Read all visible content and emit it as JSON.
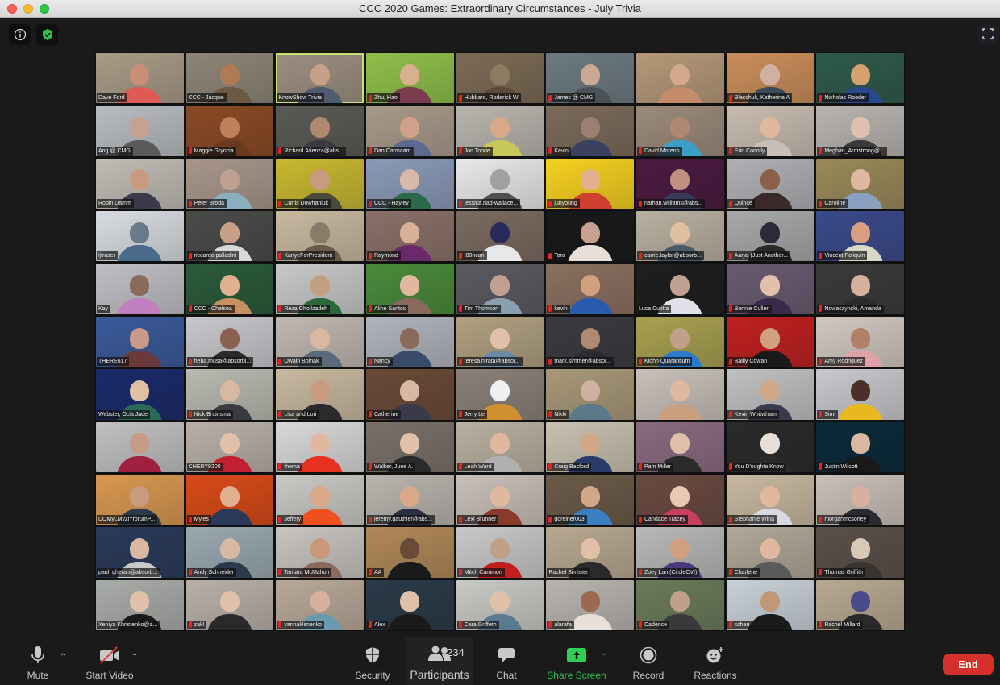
{
  "window": {
    "title": "CCC 2020 Games: Extraordinary Circumstances - July Trivia"
  },
  "top_controls": {
    "info_icon": "info-icon",
    "encryption_icon": "shield-check-icon",
    "fullscreen_icon": "fullscreen-icon"
  },
  "gallery": {
    "columns": 9,
    "active_speaker": "KnowShow Trivia",
    "tiles": [
      {
        "name": "Dave Ford",
        "muted": false,
        "bg": "#a89a86",
        "skin": "#c98f76",
        "shirt": "#e05a55"
      },
      {
        "name": "CCC - Jacque",
        "muted": false,
        "bg": "#8d8577",
        "skin": "#b07a55",
        "shirt": "#6d5a45"
      },
      {
        "name": "KnowShow Trivia",
        "muted": false,
        "bg": "#9b8f80",
        "skin": "#c7a08a",
        "shirt": "#4d5c70"
      },
      {
        "name": "Zhu, Hao",
        "muted": true,
        "bg": "#8fbf4a",
        "skin": "#d8b090",
        "shirt": "#7a3c4f"
      },
      {
        "name": "Hubbard, Roderick W",
        "muted": true,
        "bg": "#7b6a55",
        "skin": "#8e7a60",
        "shirt": "#5a4a3a"
      },
      {
        "name": "James @ CMG",
        "muted": true,
        "bg": "#6c7a80",
        "skin": "#c9a896",
        "shirt": "#4a5258"
      },
      {
        "name": "",
        "muted": false,
        "bg": "#b59878",
        "skin": "#d4a88a",
        "shirt": "#c48a6a"
      },
      {
        "name": "Blaschuk, Katherine A",
        "muted": true,
        "bg": "#c98e5a",
        "skin": "#d0b0a0",
        "shirt": "#3a4a5a"
      },
      {
        "name": "Nicholas Roeder",
        "muted": true,
        "bg": "#2e5a4a",
        "skin": "#d6a070",
        "shirt": "#2a4a90"
      },
      {
        "name": "Ang @ CMG",
        "muted": false,
        "bg": "#b8bcc0",
        "skin": "#c9a090",
        "shirt": "#5a5a5a"
      },
      {
        "name": "Maggie Gryncia",
        "muted": true,
        "bg": "#8a4a25",
        "skin": "#c0805a",
        "shirt": "#6a3a20"
      },
      {
        "name": "Richard.Atienza@abs...",
        "muted": true,
        "bg": "#5a5a55",
        "skin": "#b08870",
        "shirt": "#3a3a40"
      },
      {
        "name": "Dan Carmaam",
        "muted": true,
        "bg": "#a89a8a",
        "skin": "#d0a088",
        "shirt": "#5a6a90"
      },
      {
        "name": "Jon Toorie",
        "muted": true,
        "bg": "#b8b4ae",
        "skin": "#d8a888",
        "shirt": "#c8c85a"
      },
      {
        "name": "Kevin",
        "muted": true,
        "bg": "#7a6a5a",
        "skin": "#9a8070",
        "shirt": "#3a4060"
      },
      {
        "name": "David Moreno",
        "muted": true,
        "bg": "#9a8a7a",
        "skin": "#b08870",
        "shirt": "#3aa0c8"
      },
      {
        "name": "Erin Conolly",
        "muted": true,
        "bg": "#c8bcb0",
        "skin": "#e0b8a0",
        "shirt": "#c8c0b8"
      },
      {
        "name": "Meghan_Armstrong@...",
        "muted": true,
        "bg": "#b8b4b0",
        "skin": "#e0c0b0",
        "shirt": "#3a3a3a"
      },
      {
        "name": "Robin Damm",
        "muted": false,
        "bg": "#c0bcb4",
        "skin": "#c89a80",
        "shirt": "#3a3a4a"
      },
      {
        "name": "Peter Broda",
        "muted": true,
        "bg": "#a8968a",
        "skin": "#c0a090",
        "shirt": "#8ab0c0"
      },
      {
        "name": "Curtis Dowhaniuk",
        "muted": true,
        "bg": "#c8b830",
        "skin": "#c89a80",
        "shirt": "#4a4a3a"
      },
      {
        "name": "CCC - Hayley",
        "muted": true,
        "bg": "#8a9ab8",
        "skin": "#d8b8a8",
        "shirt": "#2a6a4a"
      },
      {
        "name": "jessica.riad-wallace...",
        "muted": true,
        "bg": "#e8e8e8",
        "skin": "#a0a0a0",
        "shirt": "#505050"
      },
      {
        "name": "junyoung",
        "muted": true,
        "bg": "#f5d020",
        "skin": "#e0b090",
        "shirt": "#d04030"
      },
      {
        "name": "nathan.williams@abs...",
        "muted": true,
        "bg": "#4a1a40",
        "skin": "#c09080",
        "shirt": "#3a3a5a"
      },
      {
        "name": "Quince",
        "muted": true,
        "bg": "#b0b0b4",
        "skin": "#8a6048",
        "shirt": "#3a2a2a"
      },
      {
        "name": "Caroline",
        "muted": true,
        "bg": "#9a8a5a",
        "skin": "#e0b8a0",
        "shirt": "#8aa0c0"
      },
      {
        "name": "ljfraser",
        "muted": false,
        "bg": "#d8dce0",
        "skin": "#6a7a8a",
        "shirt": "#4a6a8a"
      },
      {
        "name": "riccardo.palladini",
        "muted": true,
        "bg": "#4a4a48",
        "skin": "#c8a088",
        "shirt": "#d8d8d8"
      },
      {
        "name": "KanyeForPresident",
        "muted": true,
        "bg": "#c8b8a0",
        "skin": "#8a7a6a",
        "shirt": "#6a5a4a"
      },
      {
        "name": "Raymond",
        "muted": true,
        "bg": "#8a7068",
        "skin": "#d8b098",
        "shirt": "#6a2a6a"
      },
      {
        "name": "t00ncan",
        "muted": true,
        "bg": "#7a6a60",
        "skin": "#2a2a5a",
        "shirt": "#e8e8e8"
      },
      {
        "name": "Tara",
        "muted": true,
        "bg": "#181818",
        "skin": "#c8a090",
        "shirt": "#e8e0d8"
      },
      {
        "name": "carrie.taylor@absorb...",
        "muted": true,
        "bg": "#b8b0a0",
        "skin": "#e0c0a0",
        "shirt": "#4a5a6a"
      },
      {
        "name": "Aarjai (Just Another...",
        "muted": true,
        "bg": "#a8a8a8",
        "skin": "#2a2a3a",
        "shirt": "#2a2a2a"
      },
      {
        "name": "Vincent Poliquin",
        "muted": true,
        "bg": "#3a4a8a",
        "skin": "#d8a080",
        "shirt": "#d8d8c8"
      },
      {
        "name": "Kay",
        "muted": false,
        "bg": "#c0c0c4",
        "skin": "#8a6a5a",
        "shirt": "#c080c0"
      },
      {
        "name": "CCC - Chelsea",
        "muted": true,
        "bg": "#2a5a3a",
        "skin": "#e0b090",
        "shirt": "#c89060"
      },
      {
        "name": "Reza Ghollzadeh",
        "muted": true,
        "bg": "#c8c8c8",
        "skin": "#c0a080",
        "shirt": "#2a6a3a"
      },
      {
        "name": "Aline Santos",
        "muted": true,
        "bg": "#4a8a3a",
        "skin": "#e0b8a0",
        "shirt": "#8a6a5a"
      },
      {
        "name": "Tim Thomson",
        "muted": true,
        "bg": "#5a5a60",
        "skin": "#c0a090",
        "shirt": "#8aa0b0"
      },
      {
        "name": "kevin",
        "muted": true,
        "bg": "#8a7060",
        "skin": "#d0a080",
        "shirt": "#2a5ab0"
      },
      {
        "name": "Luca Cutitta",
        "muted": false,
        "bg": "#1e1e1e",
        "skin": "#c0a090",
        "shirt": "#e0e0e8"
      },
      {
        "name": "Bonnie Cullen",
        "muted": true,
        "bg": "#6a5a70",
        "skin": "#e0c0a8",
        "shirt": "#3a2a4a"
      },
      {
        "name": "Nowaczynski, Amanda",
        "muted": true,
        "bg": "#3a3a3a",
        "skin": "#d8b0a0",
        "shirt": "#2a2a2a"
      },
      {
        "name": "THERE617",
        "muted": false,
        "bg": "#3a5a9a",
        "skin": "#c89a88",
        "shirt": "#6a3a3a"
      },
      {
        "name": "heba.musa@absorbl...",
        "muted": true,
        "bg": "#c8c8cc",
        "skin": "#8a6050",
        "shirt": "#2a2a2a"
      },
      {
        "name": "Owain Bolnak",
        "muted": true,
        "bg": "#c0b8b0",
        "skin": "#d8b8a0",
        "shirt": "#5a6a7a"
      },
      {
        "name": "Nancy",
        "muted": true,
        "bg": "#b0b4bc",
        "skin": "#8a6a5a",
        "shirt": "#3a4a6a"
      },
      {
        "name": "teresa.hirata@absor...",
        "muted": true,
        "bg": "#b0a080",
        "skin": "#e0c0a8",
        "shirt": "#6a8aa8"
      },
      {
        "name": "mark.simmer@absor...",
        "muted": true,
        "bg": "#3a3a40",
        "skin": "#b08a70",
        "shirt": "#2a2a30"
      },
      {
        "name": "Klohn Quarantium",
        "muted": true,
        "bg": "#a8a050",
        "skin": "#c0a088",
        "shirt": "#2a7ad0"
      },
      {
        "name": "Bailly Cowan",
        "muted": true,
        "bg": "#c02020",
        "skin": "#d0a080",
        "shirt": "#1a1a1a"
      },
      {
        "name": "Amy Rodriguez",
        "muted": true,
        "bg": "#d0c8c0",
        "skin": "#b08068",
        "shirt": "#e0a0a8"
      },
      {
        "name": "Webster, Ocia Jade",
        "muted": false,
        "bg": "#1a2a6a",
        "skin": "#e0c0a0",
        "shirt": "#2a6a5a"
      },
      {
        "name": "Nick Bruinsma",
        "muted": true,
        "bg": "#b8bab0",
        "skin": "#d8b8a0",
        "shirt": "#3a3a40"
      },
      {
        "name": "Lisa and Lori",
        "muted": true,
        "bg": "#c8b8a0",
        "skin": "#c89a80",
        "shirt": "#2a2a2a"
      },
      {
        "name": "Catherine",
        "muted": true,
        "bg": "#6a4a38",
        "skin": "#d8b8a0",
        "shirt": "#3a3a4a"
      },
      {
        "name": "Jerry Le",
        "muted": true,
        "bg": "#8a8078",
        "skin": "#f0f0f0",
        "shirt": "#d09030"
      },
      {
        "name": "Nikki",
        "muted": true,
        "bg": "#a89878",
        "skin": "#d0b0a0",
        "shirt": "#5a7a8a"
      },
      {
        "name": "",
        "muted": false,
        "bg": "#c8c0b8",
        "skin": "#e0b8a0",
        "shirt": "#c8a080"
      },
      {
        "name": "Kevin Whitwham",
        "muted": true,
        "bg": "#c0c0c0",
        "skin": "#d0a888",
        "shirt": "#3a3a4a"
      },
      {
        "name": "Simi",
        "muted": true,
        "bg": "#c8c8cc",
        "skin": "#4a3028",
        "shirt": "#e8b820"
      },
      {
        "name": "",
        "muted": false,
        "bg": "#c0c0c0",
        "skin": "#c89a88",
        "shirt": "#a02040"
      },
      {
        "name": "CHERY9200",
        "muted": false,
        "bg": "#b8b0a8",
        "skin": "#e0c0a8",
        "shirt": "#c02030"
      },
      {
        "name": "thema",
        "muted": true,
        "bg": "#d8d8d8",
        "skin": "#e0b8a0",
        "shirt": "#e83020"
      },
      {
        "name": "Walker, June A.",
        "muted": true,
        "bg": "#7a7068",
        "skin": "#e0c0a8",
        "shirt": "#2a2a2a"
      },
      {
        "name": "Leah Ward",
        "muted": true,
        "bg": "#b8b0a0",
        "skin": "#e0b8a0",
        "shirt": "#b0b0b0"
      },
      {
        "name": "Craig Basford",
        "muted": true,
        "bg": "#c8c0b0",
        "skin": "#d0a888",
        "shirt": "#2a3a6a"
      },
      {
        "name": "Pam Miller",
        "muted": true,
        "bg": "#8a6a80",
        "skin": "#e0c0a8",
        "shirt": "#2a2a2a"
      },
      {
        "name": "You D'oughta Know",
        "muted": true,
        "bg": "#2a2a2a",
        "skin": "#e8e0d8",
        "shirt": "#2a2a2a"
      },
      {
        "name": "Justin Wilcott",
        "muted": true,
        "bg": "#0a2a3a",
        "skin": "#d8b8a0",
        "shirt": "#1a1a1a"
      },
      {
        "name": "DOMyLMvzlYforumP...",
        "muted": false,
        "bg": "#d89850",
        "skin": "#c89a80",
        "shirt": "#2a3a4a"
      },
      {
        "name": "Myles",
        "muted": true,
        "bg": "#d84a18",
        "skin": "#e0b090",
        "shirt": "#2a3a5a"
      },
      {
        "name": "Jeffery",
        "muted": true,
        "bg": "#c8c8c4",
        "skin": "#d8a888",
        "shirt": "#f05020"
      },
      {
        "name": "jeremy.gauthier@abs...",
        "muted": true,
        "bg": "#b8b4ae",
        "skin": "#d8a888",
        "shirt": "#2a3040"
      },
      {
        "name": "Lexi Brunner",
        "muted": true,
        "bg": "#c8c0b8",
        "skin": "#e0b8a0",
        "shirt": "#8a3a2a"
      },
      {
        "name": "gdreiner003",
        "muted": true,
        "bg": "#6a5a48",
        "skin": "#d0a888",
        "shirt": "#3a80c0"
      },
      {
        "name": "Candace Tracey",
        "muted": true,
        "bg": "#6a4a40",
        "skin": "#e8c8b0",
        "shirt": "#c84060"
      },
      {
        "name": "Stephanie Wina",
        "muted": true,
        "bg": "#c8b8a0",
        "skin": "#e0b8a0",
        "shirt": "#d8d8e0"
      },
      {
        "name": "morganmcsorley",
        "muted": true,
        "bg": "#c8c0b8",
        "skin": "#d8b0a0",
        "shirt": "#2a2a30"
      },
      {
        "name": "paul_gheran@absorb...",
        "muted": false,
        "bg": "#2a3a5a",
        "skin": "#d8b8a0",
        "shirt": "#c8c8c8"
      },
      {
        "name": "Andy Schneider",
        "muted": true,
        "bg": "#9aa8b0",
        "skin": "#d8b8a0",
        "shirt": "#2a3a4a"
      },
      {
        "name": "Tamara McMahon",
        "muted": true,
        "bg": "#c8c4c0",
        "skin": "#c89878",
        "shirt": "#8a6a5a"
      },
      {
        "name": "AA",
        "muted": true,
        "bg": "#b08858",
        "skin": "#6a4a38",
        "shirt": "#1a1a1a"
      },
      {
        "name": "Mitch Cammon",
        "muted": true,
        "bg": "#c8c8c8",
        "skin": "#c0a088",
        "shirt": "#c02020"
      },
      {
        "name": "Rachel Simister",
        "muted": false,
        "bg": "#b8a890",
        "skin": "#e0c0a8",
        "shirt": "#2a2a2a"
      },
      {
        "name": "Zoey Lan (CircleCVI)",
        "muted": true,
        "bg": "#b8b8b8",
        "skin": "#d0a080",
        "shirt": "#4a3a7a"
      },
      {
        "name": "Charlene",
        "muted": true,
        "bg": "#b0a898",
        "skin": "#e0b8a0",
        "shirt": "#5a5a5a"
      },
      {
        "name": "Thomas Griffith",
        "muted": true,
        "bg": "#5a5048",
        "skin": "#d8c8b8",
        "shirt": "#3a3430"
      },
      {
        "name": "Xeniya Khristenko@a...",
        "muted": false,
        "bg": "#a8aca8",
        "skin": "#e0c0a8",
        "shirt": "#1a1a1a"
      },
      {
        "name": "zakl",
        "muted": true,
        "bg": "#b8b0a8",
        "skin": "#e0c0a8",
        "shirt": "#2a2a2a"
      },
      {
        "name": "yannaklimenko",
        "muted": true,
        "bg": "#b8a898",
        "skin": "#d8b0a0",
        "shirt": "#6a9ab0"
      },
      {
        "name": "Alex",
        "muted": true,
        "bg": "#2a3a48",
        "skin": "#e0c0a8",
        "shirt": "#1a1a1a"
      },
      {
        "name": "Cara Griffeth",
        "muted": true,
        "bg": "#c8c8c4",
        "skin": "#e0c0a8",
        "shirt": "#5a7a90"
      },
      {
        "name": "alarafa",
        "muted": true,
        "bg": "#b8b4b0",
        "skin": "#9a6a50",
        "shirt": "#e8e0d8"
      },
      {
        "name": "Cadence",
        "muted": true,
        "bg": "#6a7a5a",
        "skin": "#c0a088",
        "shirt": "#3a3a3a"
      },
      {
        "name": "schan",
        "muted": true,
        "bg": "#c8d0d8",
        "skin": "#c09878",
        "shirt": "#1a1a1a"
      },
      {
        "name": "Rachel Millard",
        "muted": true,
        "bg": "#b8a890",
        "skin": "#4a4a8a",
        "shirt": "#2a2a2a"
      }
    ]
  },
  "toolbar": {
    "mute": {
      "label": "Mute",
      "icon": "microphone-icon"
    },
    "video": {
      "label": "Start Video",
      "icon": "video-off-icon"
    },
    "security": {
      "label": "Security",
      "icon": "shield-icon"
    },
    "participants": {
      "label": "Participants",
      "icon": "participants-icon",
      "count": "234"
    },
    "chat": {
      "label": "Chat",
      "icon": "chat-bubble-icon"
    },
    "share": {
      "label": "Share Screen",
      "icon": "share-up-arrow-icon"
    },
    "record": {
      "label": "Record",
      "icon": "record-icon"
    },
    "reactions": {
      "label": "Reactions",
      "icon": "smiley-plus-icon"
    },
    "end": {
      "label": "End"
    }
  },
  "colors": {
    "share_green": "#2fd155",
    "end_red": "#d5302b",
    "active_speaker_border": "#c9e26a",
    "muted_red": "#e02828"
  }
}
